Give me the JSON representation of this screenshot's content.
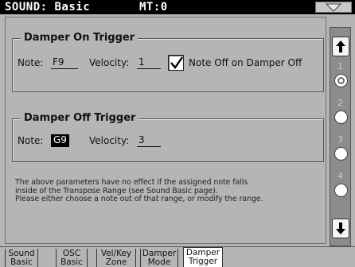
{
  "header": {
    "title": "SOUND: Basic",
    "subtitle": "MT:0"
  },
  "damper_on": {
    "title": "Damper On Trigger",
    "note_label": "Note:",
    "note_value": "F9",
    "velocity_label": "Velocity:",
    "velocity_value": "1",
    "checkbox_label": "Note Off on Damper Off",
    "checkbox_checked": true
  },
  "damper_off": {
    "title": "Damper Off Trigger",
    "note_label": "Note:",
    "note_value": "G9",
    "velocity_label": "Velocity:",
    "velocity_value": "3"
  },
  "info": {
    "line1": "The above parameters have no effect if the assigned note falls",
    "line2": "inside of the Transpose Range (see Sound Basic page).",
    "line3": "Please either choose a note out of that range, or modify the range."
  },
  "pager": {
    "pages": [
      "1",
      "2",
      "3",
      "4"
    ],
    "active_page": 1
  },
  "tabs": [
    {
      "line1": "Sound",
      "line2": "Basic"
    },
    {
      "line1": "OSC",
      "line2": "Basic"
    },
    {
      "line1": "Vel/Key",
      "line2": "Zone"
    },
    {
      "line1": "Damper",
      "line2": "Mode"
    },
    {
      "line1": "Damper",
      "line2": "Trigger"
    }
  ],
  "active_tab": 4,
  "colors": {
    "background": "#b5b5b5",
    "title_bar": "#000000",
    "selected_field": "#000000",
    "active_tab": "#ffffff"
  },
  "icons": {
    "menu": "triangle-down-icon",
    "scroll_up": "arrow-up-icon",
    "scroll_down": "arrow-down-icon",
    "checkbox": "checkmark-icon"
  }
}
